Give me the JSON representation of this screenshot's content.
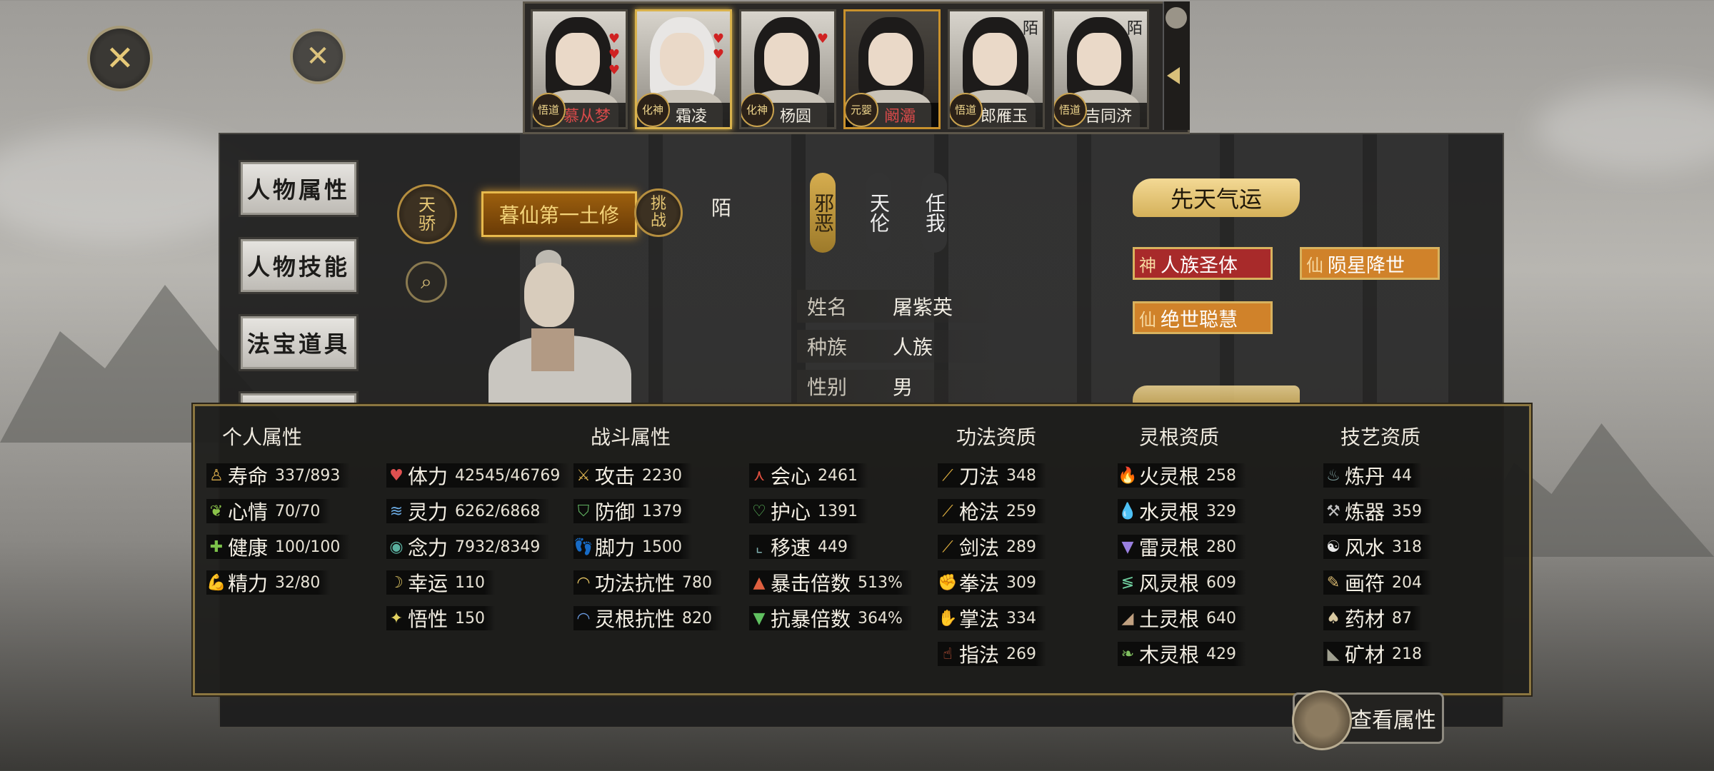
{
  "top_close_labels": [
    "✕",
    "✕"
  ],
  "characters": [
    {
      "name": "慕从梦",
      "rank": "悟道",
      "corner": "",
      "hearts": 3,
      "color": "#d84a4a"
    },
    {
      "name": "霜凌",
      "rank": "化神",
      "corner": "",
      "hearts": 2,
      "color": "#f2ede2"
    },
    {
      "name": "杨圆",
      "rank": "化神",
      "corner": "",
      "hearts": 1,
      "color": "#f2ede2"
    },
    {
      "name": "阚灞",
      "rank": "元婴",
      "corner": "",
      "hearts": 0,
      "color": "#d84a4a"
    },
    {
      "name": "郎雁玉",
      "rank": "悟道",
      "corner": "陌",
      "hearts": 0,
      "color": "#f2ede2"
    },
    {
      "name": "吉同济",
      "rank": "悟道",
      "corner": "陌",
      "hearts": 0,
      "color": "#f2ede2"
    }
  ],
  "nav": [
    "人物属性",
    "人物技能",
    "法宝道具"
  ],
  "profile": {
    "badge": "天骄",
    "title": "暮仙第一土修",
    "challenge": "挑战",
    "relation": "陌",
    "alignments": [
      {
        "text": "邪恶",
        "active": true
      },
      {
        "text": "天伦",
        "active": false
      },
      {
        "text": "任我",
        "active": false
      }
    ],
    "fields": [
      {
        "k": "姓名",
        "v": "屠紫英"
      },
      {
        "k": "种族",
        "v": "人族"
      },
      {
        "k": "性别",
        "v": "男"
      }
    ]
  },
  "innate_luck": {
    "title": "先天气运",
    "traits": [
      {
        "glyph": "神",
        "text": "人族圣体",
        "color": "#a82a2a"
      },
      {
        "glyph": "仙",
        "text": "陨星降世",
        "color": "#d0822a"
      },
      {
        "glyph": "仙",
        "text": "绝世聪慧",
        "color": "#d0822a"
      }
    ]
  },
  "stats_panel": {
    "personal": {
      "title": "个人属性",
      "items": [
        {
          "icon": "person-icon",
          "glyph": "♙",
          "color": "#d4a84a",
          "label": "寿命",
          "value": "337/893"
        },
        {
          "icon": "sprout-icon",
          "glyph": "❦",
          "color": "#8bc34a",
          "label": "心情",
          "value": "70/70"
        },
        {
          "icon": "cross-icon",
          "glyph": "✚",
          "color": "#7cc24a",
          "label": "健康",
          "value": "100/100"
        },
        {
          "icon": "arm-icon",
          "glyph": "💪",
          "color": "#e0a070",
          "label": "精力",
          "value": "32/80"
        }
      ]
    },
    "combat": {
      "title": "战斗属性",
      "col1": [
        {
          "icon": "heart-icon",
          "glyph": "♥",
          "color": "#e05050",
          "label": "体力",
          "value": "42545/46769"
        },
        {
          "icon": "wave-icon",
          "glyph": "≋",
          "color": "#6aa8e0",
          "label": "灵力",
          "value": "6262/6868"
        },
        {
          "icon": "eye-icon",
          "glyph": "◉",
          "color": "#5ab0a0",
          "label": "念力",
          "value": "7932/8349"
        },
        {
          "icon": "moon-icon",
          "glyph": "☽",
          "color": "#d8c060",
          "label": "幸运",
          "value": "110"
        },
        {
          "icon": "star-icon",
          "glyph": "✦",
          "color": "#e0d060",
          "label": "悟性",
          "value": "150"
        }
      ],
      "col2": [
        {
          "icon": "swords-icon",
          "glyph": "⚔",
          "color": "#d8b050",
          "label": "攻击",
          "value": "2230"
        },
        {
          "icon": "shield-icon",
          "glyph": "⛉",
          "color": "#60b060",
          "label": "防御",
          "value": "1379"
        },
        {
          "icon": "foot-icon",
          "glyph": "👣",
          "color": "#d0a070",
          "label": "脚力",
          "value": "1500"
        },
        {
          "icon": "arc-icon",
          "glyph": "◠",
          "color": "#e0c060",
          "label": "功法抗性",
          "value": "780"
        },
        {
          "icon": "arc-blue-icon",
          "glyph": "◠",
          "color": "#6a9ae0",
          "label": "灵根抗性",
          "value": "820"
        }
      ],
      "col3": [
        {
          "icon": "crit-icon",
          "glyph": "⋏",
          "color": "#e05040",
          "label": "会心",
          "value": "2461"
        },
        {
          "icon": "guard-heart-icon",
          "glyph": "♡",
          "color": "#60c060",
          "label": "护心",
          "value": "1391"
        },
        {
          "icon": "boot-icon",
          "glyph": "⌞",
          "color": "#80b0b0",
          "label": "移速",
          "value": "449"
        },
        {
          "icon": "crit-mult-icon",
          "glyph": "▲",
          "color": "#e06040",
          "label": "暴击倍数",
          "value": "513%"
        },
        {
          "icon": "anti-crit-icon",
          "glyph": "▼",
          "color": "#60c060",
          "label": "抗暴倍数",
          "value": "364%"
        }
      ]
    },
    "technique": {
      "title": "功法资质",
      "items": [
        {
          "icon": "blade-icon",
          "glyph": "⟋",
          "color": "#e0b040",
          "label": "刀法",
          "value": "348"
        },
        {
          "icon": "spear-icon",
          "glyph": "⟋",
          "color": "#e0b040",
          "label": "枪法",
          "value": "259"
        },
        {
          "icon": "sword-icon",
          "glyph": "⟋",
          "color": "#e0b040",
          "label": "剑法",
          "value": "289"
        },
        {
          "icon": "fist-icon",
          "glyph": "✊",
          "color": "#e07050",
          "label": "拳法",
          "value": "309"
        },
        {
          "icon": "palm-icon",
          "glyph": "✋",
          "color": "#e06040",
          "label": "掌法",
          "value": "334"
        },
        {
          "icon": "finger-icon",
          "glyph": "☝",
          "color": "#e06040",
          "label": "指法",
          "value": "269"
        }
      ]
    },
    "spirit_root": {
      "title": "灵根资质",
      "items": [
        {
          "icon": "fire-icon",
          "glyph": "🔥",
          "color": "#e05030",
          "label": "火灵根",
          "value": "258"
        },
        {
          "icon": "water-icon",
          "glyph": "💧",
          "color": "#60a0e0",
          "label": "水灵根",
          "value": "329"
        },
        {
          "icon": "thunder-icon",
          "glyph": "▼",
          "color": "#9a80e0",
          "label": "雷灵根",
          "value": "280"
        },
        {
          "icon": "wind-icon",
          "glyph": "≶",
          "color": "#70d0a0",
          "label": "风灵根",
          "value": "609"
        },
        {
          "icon": "earth-icon",
          "glyph": "◢",
          "color": "#c0a080",
          "label": "土灵根",
          "value": "640"
        },
        {
          "icon": "wood-icon",
          "glyph": "❧",
          "color": "#80c060",
          "label": "木灵根",
          "value": "429"
        }
      ]
    },
    "craft": {
      "title": "技艺资质",
      "items": [
        {
          "icon": "cauldron-icon",
          "glyph": "♨",
          "color": "#80a0a0",
          "label": "炼丹",
          "value": "44"
        },
        {
          "icon": "hammer-icon",
          "glyph": "⚒",
          "color": "#c0c0c0",
          "label": "炼器",
          "value": "359"
        },
        {
          "icon": "yinyang-icon",
          "glyph": "☯",
          "color": "#e8e8e8",
          "label": "风水",
          "value": "318"
        },
        {
          "icon": "scroll-icon",
          "glyph": "✎",
          "color": "#d8b870",
          "label": "画符",
          "value": "204"
        },
        {
          "icon": "mushroom-icon",
          "glyph": "♠",
          "color": "#d8c8a0",
          "label": "药材",
          "value": "87"
        },
        {
          "icon": "ore-icon",
          "glyph": "◣",
          "color": "#a0a090",
          "label": "矿材",
          "value": "218"
        }
      ]
    }
  },
  "view_attributes": "查看属性"
}
